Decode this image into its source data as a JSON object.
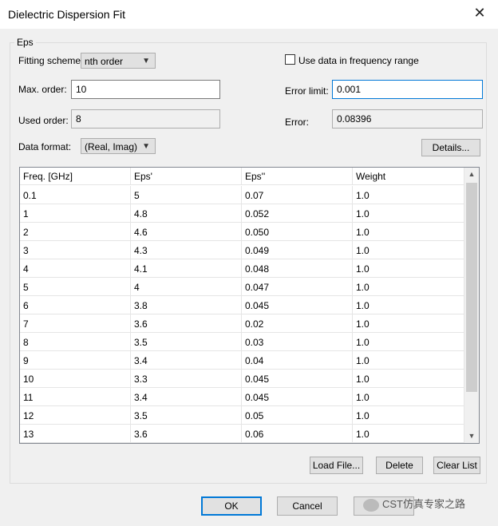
{
  "window": {
    "title": "Dielectric Dispersion Fit"
  },
  "group": {
    "label": "Eps"
  },
  "fitting_scheme": {
    "label": "Fitting scheme:",
    "value": "nth order"
  },
  "max_order": {
    "label": "Max. order:",
    "value": "10"
  },
  "used_order": {
    "label": "Used order:",
    "value": "8"
  },
  "data_format": {
    "label": "Data format:",
    "value": "(Real, Imag)"
  },
  "use_data_in_range": {
    "label": "Use data in frequency range",
    "checked": false
  },
  "error_limit": {
    "label": "Error limit:",
    "value": "0.001"
  },
  "error": {
    "label": "Error:",
    "value": "0.08396"
  },
  "details_button": "Details...",
  "table": {
    "columns": [
      "Freq. [GHz]",
      "Eps'",
      "Eps''",
      "Weight"
    ],
    "rows": [
      [
        "0.1",
        "5",
        "0.07",
        "1.0"
      ],
      [
        "1",
        "4.8",
        "0.052",
        "1.0"
      ],
      [
        "2",
        "4.6",
        "0.050",
        "1.0"
      ],
      [
        "3",
        "4.3",
        "0.049",
        "1.0"
      ],
      [
        "4",
        "4.1",
        "0.048",
        "1.0"
      ],
      [
        "5",
        "4",
        "0.047",
        "1.0"
      ],
      [
        "6",
        "3.8",
        "0.045",
        "1.0"
      ],
      [
        "7",
        "3.6",
        "0.02",
        "1.0"
      ],
      [
        "8",
        "3.5",
        "0.03",
        "1.0"
      ],
      [
        "9",
        "3.4",
        "0.04",
        "1.0"
      ],
      [
        "10",
        "3.3",
        "0.045",
        "1.0"
      ],
      [
        "11",
        "3.4",
        "0.045",
        "1.0"
      ],
      [
        "12",
        "3.5",
        "0.05",
        "1.0"
      ],
      [
        "13",
        "3.6",
        "0.06",
        "1.0"
      ]
    ]
  },
  "buttons": {
    "load_file": "Load File...",
    "delete": "Delete",
    "clear_list": "Clear List",
    "ok": "OK",
    "cancel": "Cancel",
    "apply": "Apply"
  },
  "watermark": "CST仿真专家之路"
}
